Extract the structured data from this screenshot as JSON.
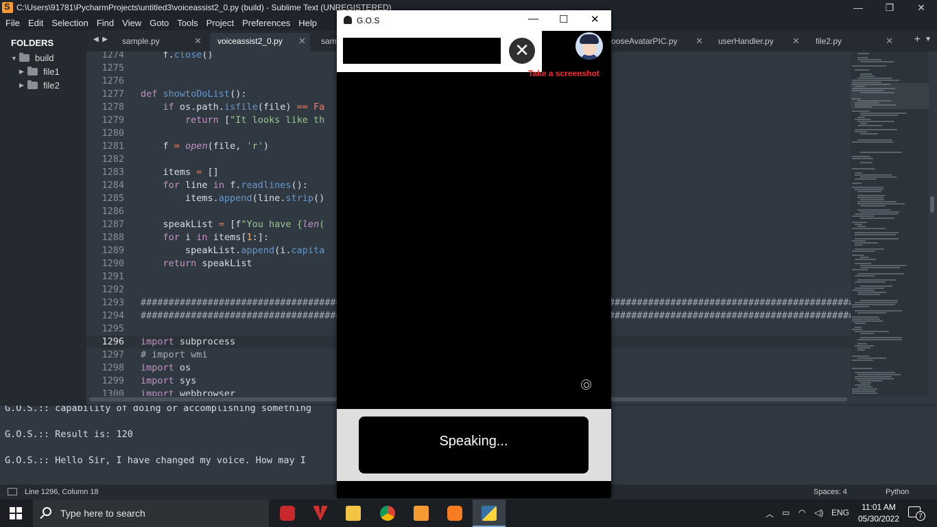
{
  "window": {
    "title": "C:\\Users\\91781\\PycharmProjects\\untitled3\\voiceassist2_0.py (build) - Sublime Text (UNREGISTERED)",
    "controls": [
      "—",
      "❐",
      "✕"
    ]
  },
  "menu": [
    "File",
    "Edit",
    "Selection",
    "Find",
    "View",
    "Goto",
    "Tools",
    "Project",
    "Preferences",
    "Help"
  ],
  "sidebar": {
    "title": "FOLDERS",
    "items": [
      {
        "label": "build",
        "expanded": true
      },
      {
        "label": "file1",
        "expanded": false
      },
      {
        "label": "file2",
        "expanded": false
      }
    ]
  },
  "tabs": [
    {
      "label": "sample.py",
      "active": false
    },
    {
      "label": "voiceassist2_0.py",
      "active": true
    },
    {
      "label": "samp",
      "active": false
    },
    {
      "label": "ooseAvatarPIC.py",
      "active": false
    },
    {
      "label": "userHandler.py",
      "active": false
    },
    {
      "label": "file2.py",
      "active": false
    }
  ],
  "editor": {
    "current_line": 1296,
    "lines": [
      {
        "n": "1274",
        "code": "    f.close()"
      },
      {
        "n": "1275",
        "code": ""
      },
      {
        "n": "1276",
        "code": ""
      },
      {
        "n": "1277",
        "code": "def showtoDoList():"
      },
      {
        "n": "1278",
        "code": "    if os.path.isfile(file) == Fa"
      },
      {
        "n": "1279",
        "code": "        return [\"It looks like th"
      },
      {
        "n": "1280",
        "code": ""
      },
      {
        "n": "1281",
        "code": "    f = open(file, 'r')"
      },
      {
        "n": "1282",
        "code": ""
      },
      {
        "n": "1283",
        "code": "    items = []"
      },
      {
        "n": "1284",
        "code": "    for line in f.readlines():"
      },
      {
        "n": "1285",
        "code": "        items.append(line.strip()"
      },
      {
        "n": "1286",
        "code": ""
      },
      {
        "n": "1287",
        "code": "    speakList = [f\"You have {len("
      },
      {
        "n": "1288",
        "code": "    for i in items[1:]:"
      },
      {
        "n": "1289",
        "code": "        speakList.append(i.capita"
      },
      {
        "n": "1290",
        "code": "    return speakList"
      },
      {
        "n": "1291",
        "code": ""
      },
      {
        "n": "1292",
        "code": ""
      },
      {
        "n": "1293",
        "code": "##############################################################################################################################################"
      },
      {
        "n": "1294",
        "code": "##############################################################################################################################################"
      },
      {
        "n": "1295",
        "code": ""
      },
      {
        "n": "1296",
        "code": "import subprocess"
      },
      {
        "n": "1297",
        "code": "# import wmi"
      },
      {
        "n": "1298",
        "code": "import os"
      },
      {
        "n": "1299",
        "code": "import sys"
      },
      {
        "n": "1300",
        "code": "import webbrowser"
      }
    ]
  },
  "console": {
    "lines": [
      "G.O.S.:: capability of doing or accomplishing something",
      "",
      "G.O.S.:: Result is: 120",
      "",
      "G.O.S.:: Hello Sir, I have changed my voice. How may I"
    ]
  },
  "statusbar": {
    "position": "Line 1296, Column 18",
    "spaces": "Spaces: 4",
    "syntax": "Python"
  },
  "gos_window": {
    "title": "G.O.S",
    "controls": [
      "—",
      "☐",
      "✕"
    ],
    "close_glyph": "✕",
    "screenshot_label": "Take a screenshot",
    "speaking_label": "Speaking..."
  },
  "taskbar": {
    "search_placeholder": "Type here to search",
    "apps": [
      "camera-recorder",
      "vs-app",
      "file-explorer",
      "chrome",
      "sublime-text",
      "xampp",
      "python"
    ],
    "language": "ENG",
    "time": "11:01 AM",
    "date": "05/30/2022",
    "notification_count": "7"
  },
  "colors": {
    "editor_bg": "#303841",
    "sidebar_bg": "#252a31",
    "accent_red": "#ff2a2a",
    "keyword": "#c594c5",
    "function": "#6699cc",
    "string": "#99c794"
  }
}
